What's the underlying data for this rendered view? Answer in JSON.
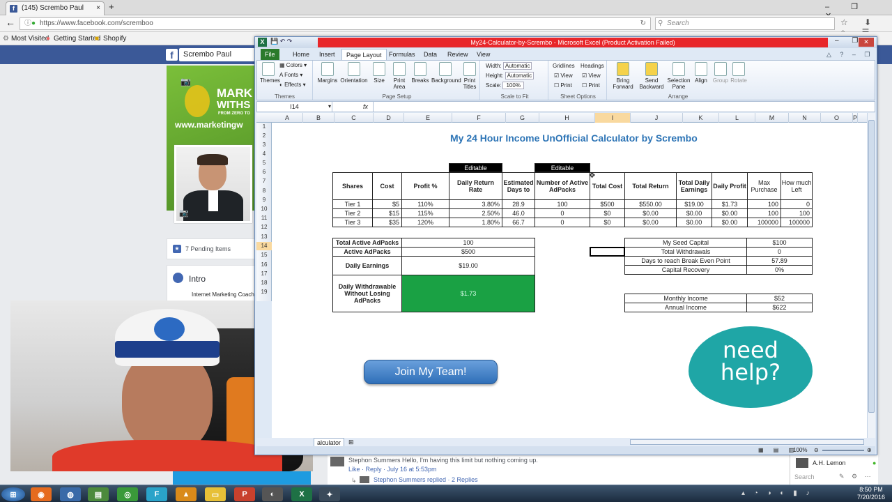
{
  "browser": {
    "tab_title": "(145) Scrembo Paul",
    "new_tab": "+",
    "url": "https://www.facebook.com/scremboo",
    "search_placeholder": "Search",
    "bookmarks": [
      "Most Visited",
      "Getting Started",
      "Shopify"
    ]
  },
  "facebook": {
    "page_name": "Scrembo Paul",
    "cover_text_1": "MARK",
    "cover_text_2": "WITHS",
    "cover_text_3": "FROM ZERO TO",
    "cover_url": "www.marketingw",
    "pending_items": "7 Pending Items",
    "intro_title": "Intro",
    "intro_text": "Internet Marketing Coach",
    "comment_text": "Stephon Summers Hello, I'm having this limit but nothing coming up.",
    "comment_meta": "Like · Reply · July 16 at 5:53pm",
    "reply_text": "Stephon Summers replied · 2 Replies",
    "chat_name": "A.H. Lemon",
    "chat_search": "Search"
  },
  "excel": {
    "title": "My24-Calculator-by-Scrembo  -  Microsoft Excel (Product Activation Failed)",
    "tabs": [
      "File",
      "Home",
      "Insert",
      "Page Layout",
      "Formulas",
      "Data",
      "Review",
      "View"
    ],
    "ribbon": {
      "themes": {
        "label": "Themes",
        "items": [
          "Themes",
          "Colors",
          "Fonts",
          "Effects"
        ]
      },
      "page_setup": {
        "label": "Page Setup",
        "items": [
          "Margins",
          "Orientation",
          "Size",
          "Print Area",
          "Breaks",
          "Background",
          "Print Titles"
        ]
      },
      "scale_to_fit": {
        "label": "Scale to Fit",
        "width_label": "Width:",
        "width_value": "Automatic",
        "height_label": "Height:",
        "height_value": "Automatic",
        "scale_label": "Scale:",
        "scale_value": "100%"
      },
      "sheet_options": {
        "label": "Sheet Options",
        "gridlines": "Gridlines",
        "headings": "Headings",
        "view": "View",
        "print": "Print"
      },
      "arrange": {
        "label": "Arrange",
        "items": [
          "Bring Forward",
          "Send Backward",
          "Selection Pane",
          "Align",
          "Group",
          "Rotate"
        ]
      }
    },
    "name_box": "I14",
    "fx": "fx",
    "columns": [
      "A",
      "B",
      "C",
      "D",
      "E",
      "F",
      "G",
      "H",
      "I",
      "J",
      "K",
      "L",
      "M",
      "N",
      "O",
      "P"
    ],
    "selected_column": "I",
    "rows": [
      "1",
      "2",
      "3",
      "4",
      "5",
      "6",
      "7",
      "8",
      "9",
      "10",
      "11",
      "12",
      "13",
      "14",
      "15",
      "16",
      "17",
      "18",
      "19"
    ],
    "selected_row": "14",
    "sheet": {
      "title": "My 24 Hour Income UnOfficial Calculator  by Scrembo",
      "editable": "Editable",
      "headers": [
        "Shares",
        "Cost",
        "Profit %",
        "Daily Return Rate",
        "Estimated Days to",
        "Number of Active AdPacks",
        "Total Cost",
        "Total Return",
        "Total Daily Earnings",
        "Daily Profit",
        "Max Purchase",
        "How much Left"
      ],
      "tiers": [
        [
          "Tier 1",
          "$5",
          "110%",
          "3.80%",
          "28.9",
          "100",
          "$500",
          "$550.00",
          "$19.00",
          "$1.73",
          "100",
          "0"
        ],
        [
          "Tier 2",
          "$15",
          "115%",
          "2.50%",
          "46.0",
          "0",
          "$0",
          "$0.00",
          "$0.00",
          "$0.00",
          "100",
          "100"
        ],
        [
          "Tier 3",
          "$35",
          "120%",
          "1.80%",
          "66.7",
          "0",
          "$0",
          "$0.00",
          "$0.00",
          "$0.00",
          "100000",
          "100000"
        ]
      ],
      "summary_left": [
        {
          "label": "Total Active AdPacks",
          "value": "100"
        },
        {
          "label": "Active AdPacks",
          "value": "$500"
        },
        {
          "label": "Daily Earnings",
          "value": "$19.00"
        },
        {
          "label": "Daily Withdrawable Without Losing AdPacks",
          "value": "$1.73"
        }
      ],
      "summary_right": [
        {
          "label": "My Seed Capital",
          "value": "$100"
        },
        {
          "label": "Total Withdrawals",
          "value": "0"
        },
        {
          "label": "Days to reach Break Even Point",
          "value": "57.89"
        },
        {
          "label": "Capital Recovery",
          "value": "0%"
        }
      ],
      "income": [
        {
          "label": "Monthly Income",
          "value": "$52"
        },
        {
          "label": "Annual Income",
          "value": "$622"
        }
      ],
      "join_button": "Join My Team!",
      "need_help_1": "need",
      "need_help_2": "help?"
    },
    "sheet_tab": "alculator",
    "zoom": "100%"
  },
  "taskbar": {
    "time": "8:50 PM",
    "date": "7/20/2016"
  },
  "colors": {
    "excel_green": "#1aa144",
    "title_blue": "#2e75b6",
    "facebook_blue": "#3b5998",
    "teal": "#1fa6a6"
  }
}
